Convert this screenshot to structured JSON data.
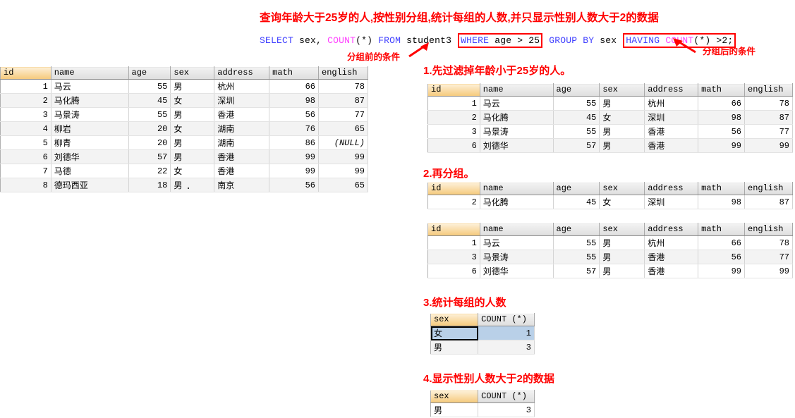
{
  "title": "查询年龄大于25岁的人,按性别分组,统计每组的人数,并只显示性别人数大于2的数据",
  "sql": {
    "select_kw": "SELECT",
    "sex_col": "sex,",
    "count_fn": "COUNT",
    "count_args": "(*)",
    "from_kw": "FROM",
    "table_name": "student3",
    "where_kw": "WHERE",
    "where_expr": "age > 25",
    "group_kw": "GROUP BY",
    "group_col": "sex",
    "having_kw": "HAVING",
    "having_fn": "COUNT",
    "having_args": "(*)",
    "having_expr": ">2;"
  },
  "annotations": {
    "before_group": "分组前的条件",
    "after_group": "分组后的条件"
  },
  "steps": {
    "step1": "1.先过滤掉年龄小于25岁的人。",
    "step2": "2.再分组。",
    "step3": "3.统计每组的人数",
    "step4": "4.显示性别人数大于2的数据"
  },
  "columns": [
    "id",
    "name",
    "age",
    "sex",
    "address",
    "math",
    "english"
  ],
  "count_columns": [
    "sex",
    "COUNT (*)"
  ],
  "source_table": {
    "rows": [
      [
        "1",
        "马云",
        "55",
        "男",
        "杭州",
        "66",
        "78"
      ],
      [
        "2",
        "马化腾",
        "45",
        "女",
        "深圳",
        "98",
        "87"
      ],
      [
        "3",
        "马景涛",
        "55",
        "男",
        "香港",
        "56",
        "77"
      ],
      [
        "4",
        "柳岩",
        "20",
        "女",
        "湖南",
        "76",
        "65"
      ],
      [
        "5",
        "柳青",
        "20",
        "男",
        "湖南",
        "86",
        "(NULL)"
      ],
      [
        "6",
        "刘德华",
        "57",
        "男",
        "香港",
        "99",
        "99"
      ],
      [
        "7",
        "马德",
        "22",
        "女",
        "香港",
        "99",
        "99"
      ],
      [
        "8",
        "德玛西亚",
        "18",
        "男",
        "南京",
        "56",
        "65"
      ]
    ]
  },
  "filtered_table": {
    "rows": [
      [
        "1",
        "马云",
        "55",
        "男",
        "杭州",
        "66",
        "78"
      ],
      [
        "2",
        "马化腾",
        "45",
        "女",
        "深圳",
        "98",
        "87"
      ],
      [
        "3",
        "马景涛",
        "55",
        "男",
        "香港",
        "56",
        "77"
      ],
      [
        "6",
        "刘德华",
        "57",
        "男",
        "香港",
        "99",
        "99"
      ]
    ]
  },
  "group_female": {
    "rows": [
      [
        "2",
        "马化腾",
        "45",
        "女",
        "深圳",
        "98",
        "87"
      ]
    ]
  },
  "group_male": {
    "rows": [
      [
        "1",
        "马云",
        "55",
        "男",
        "杭州",
        "66",
        "78"
      ],
      [
        "3",
        "马景涛",
        "55",
        "男",
        "香港",
        "56",
        "77"
      ],
      [
        "6",
        "刘德华",
        "57",
        "男",
        "香港",
        "99",
        "99"
      ]
    ]
  },
  "counts_all": {
    "rows": [
      [
        "女",
        "1"
      ],
      [
        "男",
        "3"
      ]
    ],
    "selected_index": 0
  },
  "counts_having": {
    "rows": [
      [
        "男",
        "3"
      ]
    ]
  },
  "colors": {
    "accent_red": "#ff0000",
    "keyword_blue": "#4040ff",
    "function_magenta": "#ff40ff",
    "pk_header": "#f5c97a",
    "selection_blue": "#b9d0e8"
  }
}
